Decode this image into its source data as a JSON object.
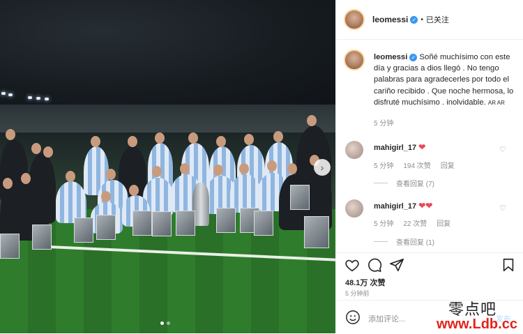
{
  "header": {
    "username": "leomessi",
    "separator": "•",
    "follow_status": "已关注"
  },
  "caption": {
    "username": "leomessi",
    "text": "Soñé muchísimo con este día y gracias a dios llegó . No tengo palabras para agradecerles por todo el cariño recibido . Que noche hermosa, lo disfruté muchísimo . inolvidable.",
    "flag": "AR AR",
    "time": "5 分钟"
  },
  "comments": [
    {
      "username": "mahigirl_17",
      "hearts": "❤",
      "time": "5 分钟",
      "likes": "194 次赞",
      "reply": "回复",
      "view_replies": "查看回复 (7)"
    },
    {
      "username": "mahigirl_17",
      "hearts": "❤❤",
      "time": "5 分钟",
      "likes": "22 次赞",
      "reply": "回复",
      "view_replies": "查看回复 (1)"
    }
  ],
  "actions": {
    "likes": "48.1万 次赞",
    "time_ago": "5 分钟前"
  },
  "add_comment": {
    "placeholder": "添加评论...",
    "publish": "发布"
  },
  "watermark": {
    "line1": "零点吧",
    "line2": "www.Ldb.cc"
  },
  "icons": [
    "verified-icon",
    "heart-icon",
    "comment-icon",
    "share-icon",
    "bookmark-icon",
    "emoji-icon",
    "next-arrow-icon"
  ],
  "colors": {
    "verified": "#3897f0",
    "heart": "#ed4956",
    "watermark_red": "#e2231a"
  },
  "carousel": {
    "total_slides": 2,
    "active_slide": 1
  }
}
